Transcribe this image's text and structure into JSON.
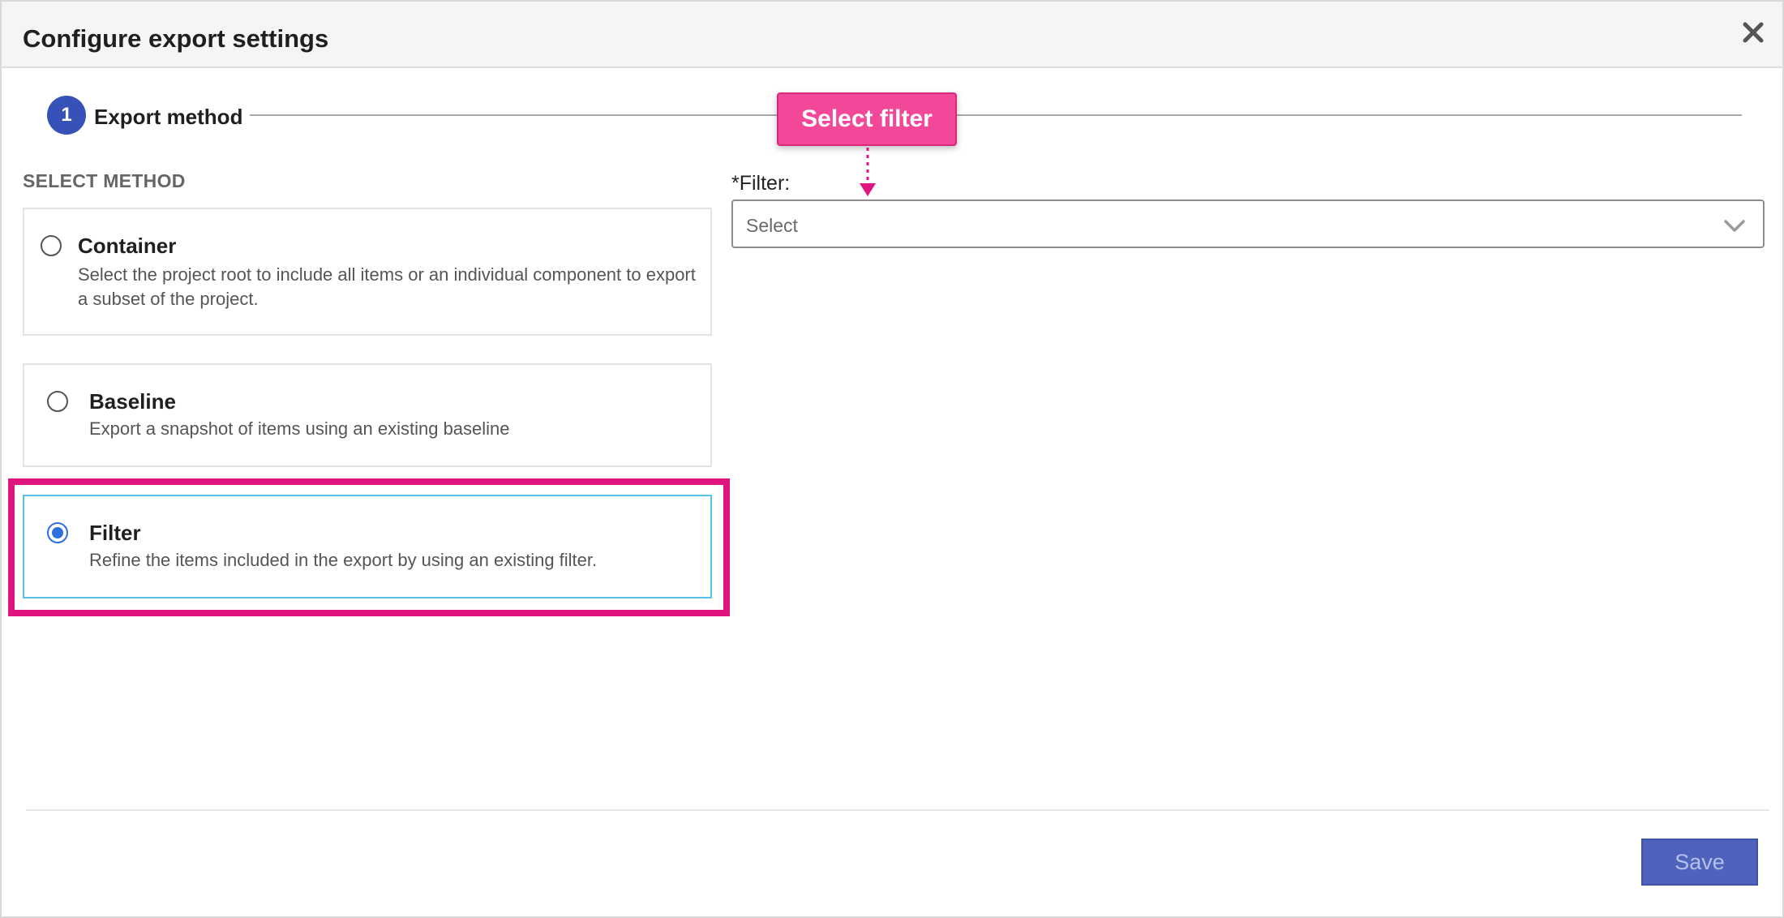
{
  "dialog": {
    "title": "Configure export settings"
  },
  "stepper": {
    "step_number": "1",
    "step_label": "Export method"
  },
  "method": {
    "section_label": "SELECT METHOD",
    "options": [
      {
        "title": "Container",
        "description": "Select the project root to include all items or an individual component to export a subset of the project.",
        "selected": false
      },
      {
        "title": "Baseline",
        "description": "Export a snapshot of items using an existing baseline",
        "selected": false
      },
      {
        "title": "Filter",
        "description": "Refine the items included in the export by using an existing filter.",
        "selected": true
      }
    ]
  },
  "filter_field": {
    "label": "*Filter:",
    "value": "Select"
  },
  "callout": {
    "text": "Select filter",
    "color": "#f3489a"
  },
  "footer": {
    "save_label": "Save"
  },
  "colors": {
    "highlight": "#e0147f",
    "accent": "#3651b8",
    "selected_border": "#56c2ea"
  },
  "icons": {
    "close": "close-icon",
    "dropdown": "chevron-down-icon"
  }
}
